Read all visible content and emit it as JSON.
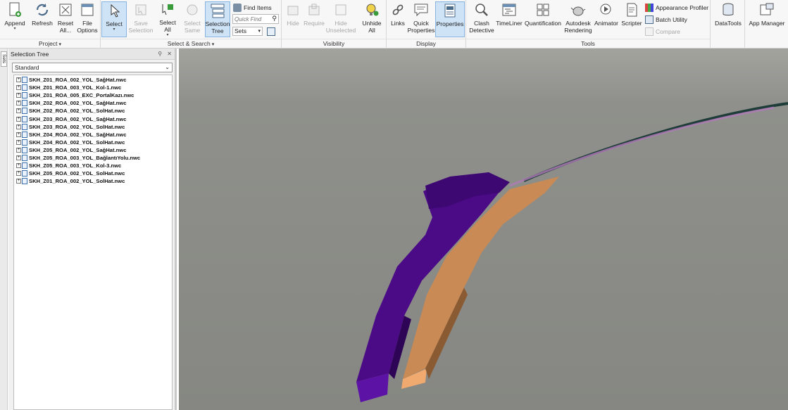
{
  "ribbon": {
    "project": {
      "label": "Project",
      "append": "Append",
      "refresh": "Refresh",
      "reset_all": "Reset\nAll...",
      "file_options": "File\nOptions"
    },
    "select_search": {
      "label": "Select & Search",
      "select": "Select",
      "save_selection": "Save\nSelection",
      "select_all": "Select\nAll",
      "select_same": "Select\nSame",
      "selection_tree": "Selection\nTree",
      "find_items": "Find Items",
      "quick_find_placeholder": "Quick Find",
      "sets": "Sets"
    },
    "visibility": {
      "label": "Visibility",
      "hide": "Hide",
      "require": "Require",
      "hide_unselected": "Hide\nUnselected",
      "unhide_all": "Unhide\nAll"
    },
    "display": {
      "label": "Display",
      "links": "Links",
      "quick_properties": "Quick\nProperties",
      "properties": "Properties"
    },
    "tools": {
      "label": "Tools",
      "clash_detective": "Clash\nDetective",
      "timeliner": "TimeLiner",
      "quantification": "Quantification",
      "autodesk_rendering": "Autodesk\nRendering",
      "animator": "Animator",
      "scripter": "Scripter",
      "appearance_profiler": "Appearance Profiler",
      "batch_utility": "Batch Utility",
      "compare": "Compare"
    },
    "datatools": "DataTools",
    "app_manager": "App Manager"
  },
  "side_tab": "Sets",
  "selection_tree": {
    "title": "Selection Tree",
    "mode": "Standard",
    "items": [
      "SKH_Z01_ROA_002_YOL_SağHat.nwc",
      "SKH_Z01_ROA_003_YOL_Kol-1.nwc",
      "SKH_Z01_ROA_005_EXC_PortalKazı.nwc",
      "SKH_Z02_ROA_002_YOL_SağHat.nwc",
      "SKH_Z02_ROA_002_YOL_SolHat.nwc",
      "SKH_Z03_ROA_002_YOL_SağHat.nwc",
      "SKH_Z03_ROA_002_YOL_SolHat.nwc",
      "SKH_Z04_ROA_002_YOL_SağHat.nwc",
      "SKH_Z04_ROA_002_YOL_SolHat.nwc",
      "SKH_Z05_ROA_002_YOL_SağHat.nwc",
      "SKH_Z05_ROA_003_YOL_BağlantıYolu.nwc",
      "SKH_Z05_ROA_003_YOL_Kol-3.nwc",
      "SKH_Z05_ROA_002_YOL_SolHat.nwc",
      "SKH_Z01_ROA_002_YOL_SolHat.nwc"
    ]
  },
  "colors": {
    "accent_active": "#cfe3f7",
    "model_purple": "#4b0a86",
    "model_orange": "#c98a55",
    "viewport_bg": "#8a8b86"
  }
}
